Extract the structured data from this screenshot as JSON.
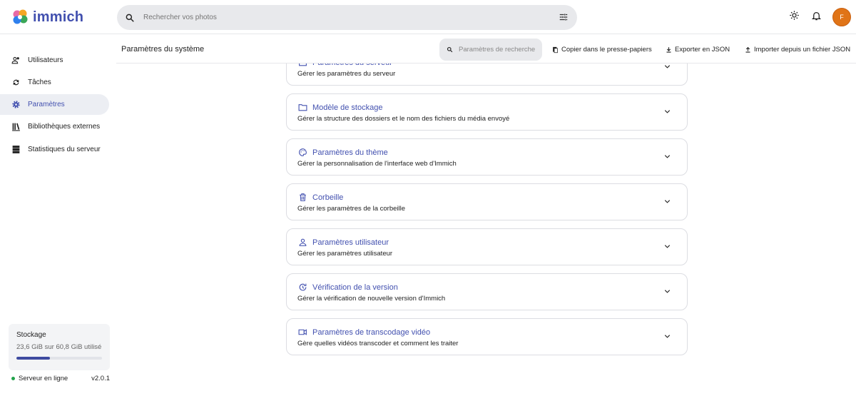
{
  "app": {
    "name": "immich"
  },
  "search": {
    "placeholder": "Rechercher vos photos"
  },
  "user": {
    "initial": "F",
    "avatar_color": "#e07417"
  },
  "accent": "#4250af",
  "sidebar": {
    "items": [
      {
        "label": "Utilisateurs",
        "icon": "users-icon"
      },
      {
        "label": "Tâches",
        "icon": "sync-icon"
      },
      {
        "label": "Paramètres",
        "icon": "gear-icon",
        "active": true
      },
      {
        "label": "Bibliothèques externes",
        "icon": "library-icon"
      },
      {
        "label": "Statistiques du serveur",
        "icon": "server-icon"
      }
    ],
    "storage": {
      "title": "Stockage",
      "usage": "23,6 GiB sur 60,8 GiB utilisé",
      "used_fraction": 0.388
    },
    "status": {
      "label": "Serveur en ligne",
      "version": "v2.0.1"
    }
  },
  "header": {
    "title": "Paramètres du système",
    "search_placeholder": "Paramètres de recherche",
    "copy": "Copier dans le presse-papiers",
    "export": "Exporter en JSON",
    "import": "Importer depuis un fichier JSON"
  },
  "cards": [
    {
      "title": "Paramètres du serveur",
      "desc": "Gérer les paramètres du serveur",
      "icon": "server-icon"
    },
    {
      "title": "Modèle de stockage",
      "desc": "Gérer la structure des dossiers et le nom des fichiers du média envoyé",
      "icon": "folder-icon"
    },
    {
      "title": "Paramètres du thème",
      "desc": "Gérer la personnalisation de l'interface web d'Immich",
      "icon": "palette-icon"
    },
    {
      "title": "Corbeille",
      "desc": "Gérer les paramètres de la corbeille",
      "icon": "trash-icon"
    },
    {
      "title": "Paramètres utilisateur",
      "desc": "Gérer les paramètres utilisateur",
      "icon": "user-icon"
    },
    {
      "title": "Vérification de la version",
      "desc": "Gérer la vérification de nouvelle version d'Immich",
      "icon": "update-icon"
    },
    {
      "title": "Paramètres de transcodage vidéo",
      "desc": "Gère quelles vidéos transcoder et comment les traiter",
      "icon": "video-icon"
    }
  ]
}
